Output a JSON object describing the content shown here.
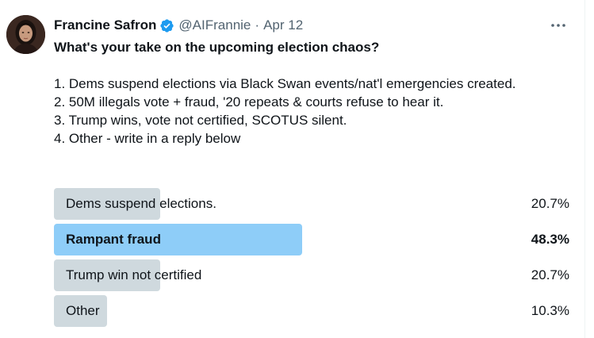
{
  "author": {
    "display_name": "Francine Safron",
    "handle": "@AIFrannie",
    "separator": "·",
    "date": "Apr 12",
    "verified_badge_color": "#1d9bf0",
    "avatar_icon": "avatar-photo"
  },
  "tweet": {
    "question": "What's your take on the upcoming election chaos?",
    "lines": [
      "1. Dems suspend elections via Black Swan events/nat'l emergencies created.",
      "2. 50M illegals vote + fraud, '20 repeats & courts refuse to hear it.",
      "3. Trump wins, vote not certified, SCOTUS silent.",
      "4. Other - write in a reply below"
    ]
  },
  "poll": {
    "options": [
      {
        "label": "Dems suspend elections.",
        "percent_text": "20.7%",
        "percent": 20.7,
        "winner": false
      },
      {
        "label": "Rampant fraud",
        "percent_text": "48.3%",
        "percent": 48.3,
        "winner": true
      },
      {
        "label": "Trump win not certified",
        "percent_text": "20.7%",
        "percent": 20.7,
        "winner": false
      },
      {
        "label": "Other",
        "percent_text": "10.3%",
        "percent": 10.3,
        "winner": false
      }
    ],
    "bar_color": "#cfd9de",
    "winner_bar_color": "#8ecdf8"
  },
  "icons": {
    "more": "more-options-icon",
    "verified": "verified-badge-icon"
  }
}
